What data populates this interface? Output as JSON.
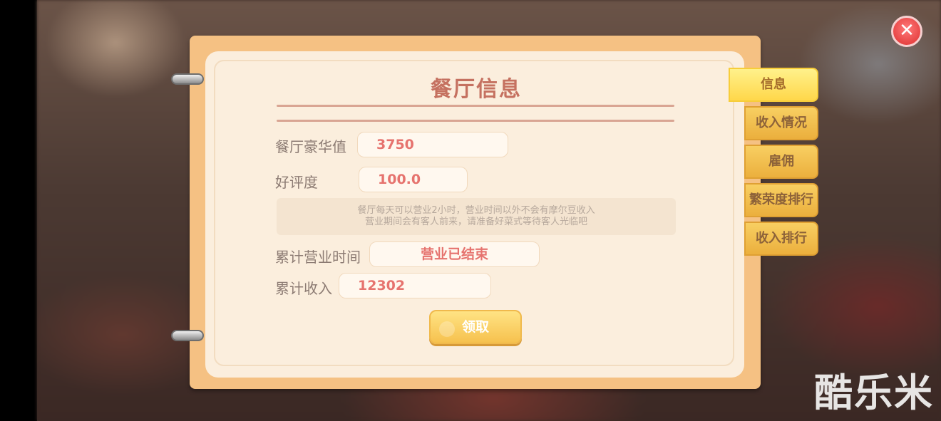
{
  "dialog": {
    "title": "餐厅信息",
    "fields": [
      {
        "label": "餐厅豪华值",
        "value": "3750"
      },
      {
        "label": "好评度",
        "value": "100.0"
      },
      {
        "label": "累计营业时间",
        "value": "营业已结束"
      },
      {
        "label": "累计收入",
        "value": "12302"
      }
    ],
    "notice_line1": "餐厅每天可以营业2小时，营业时间以外不会有摩尔豆收入",
    "notice_line2": "营业期间会有客人前来，请准备好菜式等待客人光临吧",
    "claim_label": "领取"
  },
  "tabs": [
    {
      "label": "信息",
      "active": true
    },
    {
      "label": "收入情况",
      "active": false
    },
    {
      "label": "雇佣",
      "active": false
    },
    {
      "label": "繁荣度排行",
      "active": false
    },
    {
      "label": "收入排行",
      "active": false
    }
  ],
  "close_icon": "close-icon",
  "watermark": "酷乐米",
  "colors": {
    "accent_text": "#e6736e",
    "title": "#c57160",
    "tab": "#f8cf62",
    "close": "#e84545"
  }
}
